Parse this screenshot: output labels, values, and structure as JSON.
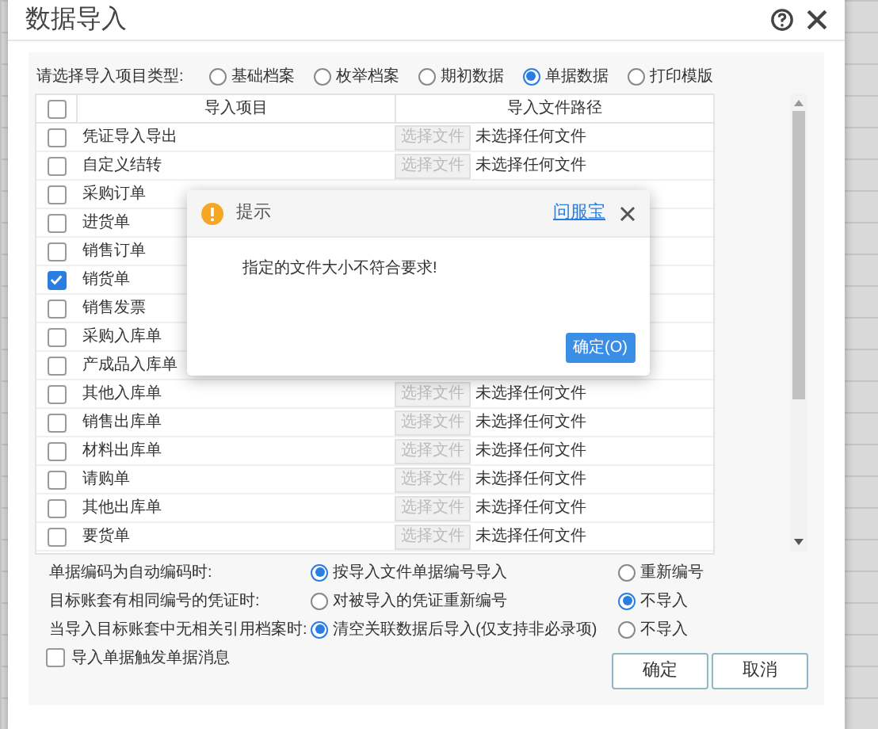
{
  "window": {
    "title": "数据导入"
  },
  "type_selector": {
    "label": "请选择导入项目类型:",
    "options": [
      {
        "label": "基础档案",
        "selected": false
      },
      {
        "label": "枚举档案",
        "selected": false
      },
      {
        "label": "期初数据",
        "selected": false
      },
      {
        "label": "单据数据",
        "selected": true
      },
      {
        "label": "打印模版",
        "selected": false
      }
    ]
  },
  "table": {
    "select_all_checked": false,
    "columns": [
      "导入项目",
      "导入文件路径"
    ],
    "rows": [
      {
        "name": "凭证导入导出",
        "checked": false,
        "button": "选择文件",
        "path": "未选择任何文件"
      },
      {
        "name": "自定义结转",
        "checked": false,
        "button": "选择文件",
        "path": "未选择任何文件"
      },
      {
        "name": "采购订单",
        "checked": false
      },
      {
        "name": "进货单",
        "checked": false
      },
      {
        "name": "销售订单",
        "checked": false
      },
      {
        "name": "销货单",
        "checked": true
      },
      {
        "name": "销售发票",
        "checked": false
      },
      {
        "name": "采购入库单",
        "checked": false
      },
      {
        "name": "产成品入库单",
        "checked": false
      },
      {
        "name": "其他入库单",
        "checked": false,
        "button": "选择文件",
        "path": "未选择任何文件"
      },
      {
        "name": "销售出库单",
        "checked": false,
        "button": "选择文件",
        "path": "未选择任何文件"
      },
      {
        "name": "材料出库单",
        "checked": false,
        "button": "选择文件",
        "path": "未选择任何文件"
      },
      {
        "name": "请购单",
        "checked": false,
        "button": "选择文件",
        "path": "未选择任何文件"
      },
      {
        "name": "其他出库单",
        "checked": false,
        "button": "选择文件",
        "path": "未选择任何文件"
      },
      {
        "name": "要货单",
        "checked": false,
        "button": "选择文件",
        "path": "未选择任何文件"
      }
    ]
  },
  "settings": [
    {
      "label": "单据编码为自动编码时:",
      "options": [
        {
          "label": "按导入文件单据编号导入",
          "selected": true
        },
        {
          "label": "重新编号",
          "selected": false
        }
      ]
    },
    {
      "label": "目标账套有相同编号的凭证时:",
      "options": [
        {
          "label": "对被导入的凭证重新编号",
          "selected": false
        },
        {
          "label": "不导入",
          "selected": true
        }
      ]
    },
    {
      "label": "当导入目标账套中无相关引用档案时:",
      "options": [
        {
          "label": "清空关联数据后导入(仅支持非必录项)",
          "selected": true
        },
        {
          "label": "不导入",
          "selected": false
        }
      ]
    }
  ],
  "trigger_message": {
    "label": "导入单据触发单据消息",
    "checked": false
  },
  "buttons": [
    "确定",
    "取消"
  ],
  "alert": {
    "title": "提示",
    "help_link": "问服宝",
    "message": "指定的文件大小不符合要求!",
    "button": "确定(O)"
  }
}
